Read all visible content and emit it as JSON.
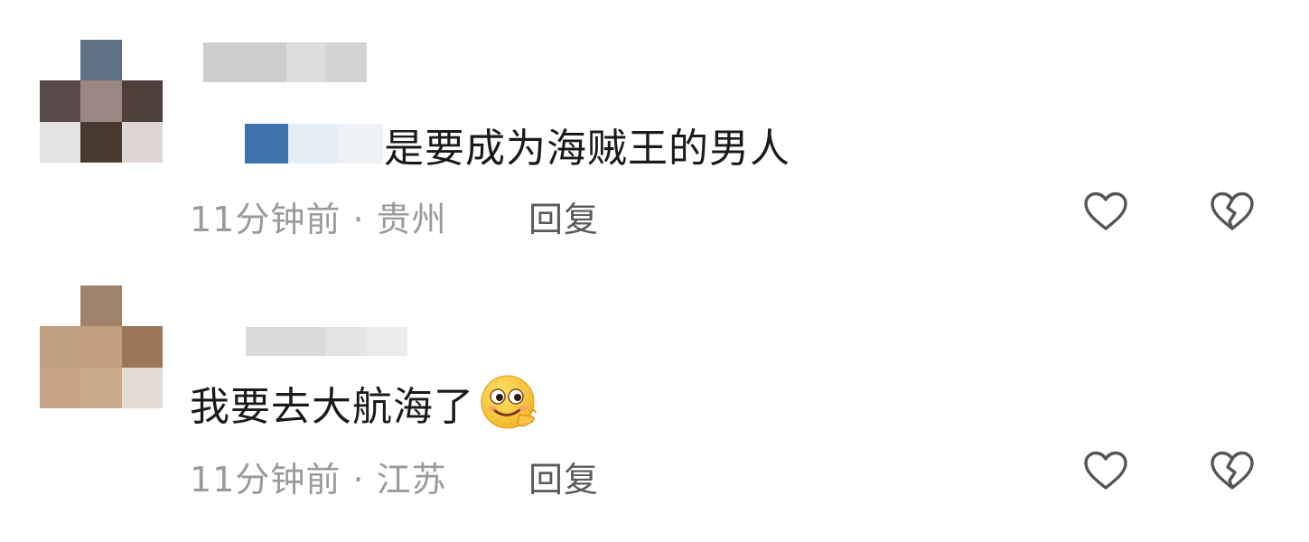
{
  "comments": [
    {
      "avatar_colors": [
        "#ffffff",
        "#5f7186",
        "#ffffff",
        "#574a48",
        "#9b8683",
        "#4f3f3c",
        "#e3e3e3",
        "#483a31",
        "#ddd6d4"
      ],
      "username_blur": [
        "#cdcdcd",
        "#dcdcdc",
        "#d3d3d3"
      ],
      "mention_blur": [
        "#3f73ad",
        "#e6eef5",
        "#eef2f6"
      ],
      "text": "是要成为海贼王的男人",
      "time": "11分钟前",
      "location": "贵州",
      "reply_label": "回复",
      "like_icon": "heart-outline-icon",
      "dislike_icon": "broken-heart-outline-icon"
    },
    {
      "avatar_colors": [
        "#ffffff",
        "#a1826c",
        "#ffffff",
        "#c1a07f",
        "#c19e7d",
        "#9d7558",
        "#c7a584",
        "#c9ab8a",
        "#e4dcd4"
      ],
      "username_blur": [
        "#dadada",
        "#e4e4e4",
        "#ececec"
      ],
      "text": "我要去大航海了",
      "emoji": "smirk-emoji",
      "time": "11分钟前",
      "location": "江苏",
      "reply_label": "回复",
      "like_icon": "heart-outline-icon",
      "dislike_icon": "broken-heart-outline-icon"
    }
  ],
  "meta_separator": " · "
}
